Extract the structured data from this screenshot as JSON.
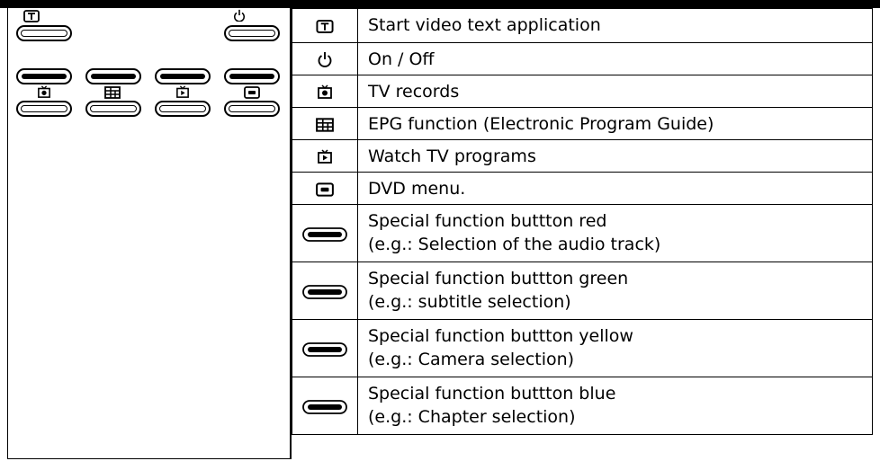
{
  "legend": {
    "rows": [
      {
        "icon": "teletext-icon",
        "lines": [
          "Start video text application"
        ]
      },
      {
        "icon": "power-icon",
        "lines": [
          "On / Off"
        ]
      },
      {
        "icon": "tv-record-icon",
        "lines": [
          "TV records"
        ]
      },
      {
        "icon": "epg-grid-icon",
        "lines": [
          "EPG function (Electronic Program Guide)"
        ]
      },
      {
        "icon": "tv-play-icon",
        "lines": [
          "Watch TV programs"
        ]
      },
      {
        "icon": "dvd-menu-icon",
        "lines": [
          "DVD menu."
        ]
      },
      {
        "icon": "function-button-icon",
        "lines": [
          "Special function buttton red",
          "(e.g.: Selection of the audio track)"
        ]
      },
      {
        "icon": "function-button-icon",
        "lines": [
          "Special function buttton green",
          "(e.g.: subtitle selection)"
        ]
      },
      {
        "icon": "function-button-icon",
        "lines": [
          "Special function buttton yellow",
          "(e.g.: Camera selection)"
        ]
      },
      {
        "icon": "function-button-icon",
        "lines": [
          "Special function buttton blue",
          "(e.g.: Chapter selection)"
        ]
      }
    ]
  }
}
